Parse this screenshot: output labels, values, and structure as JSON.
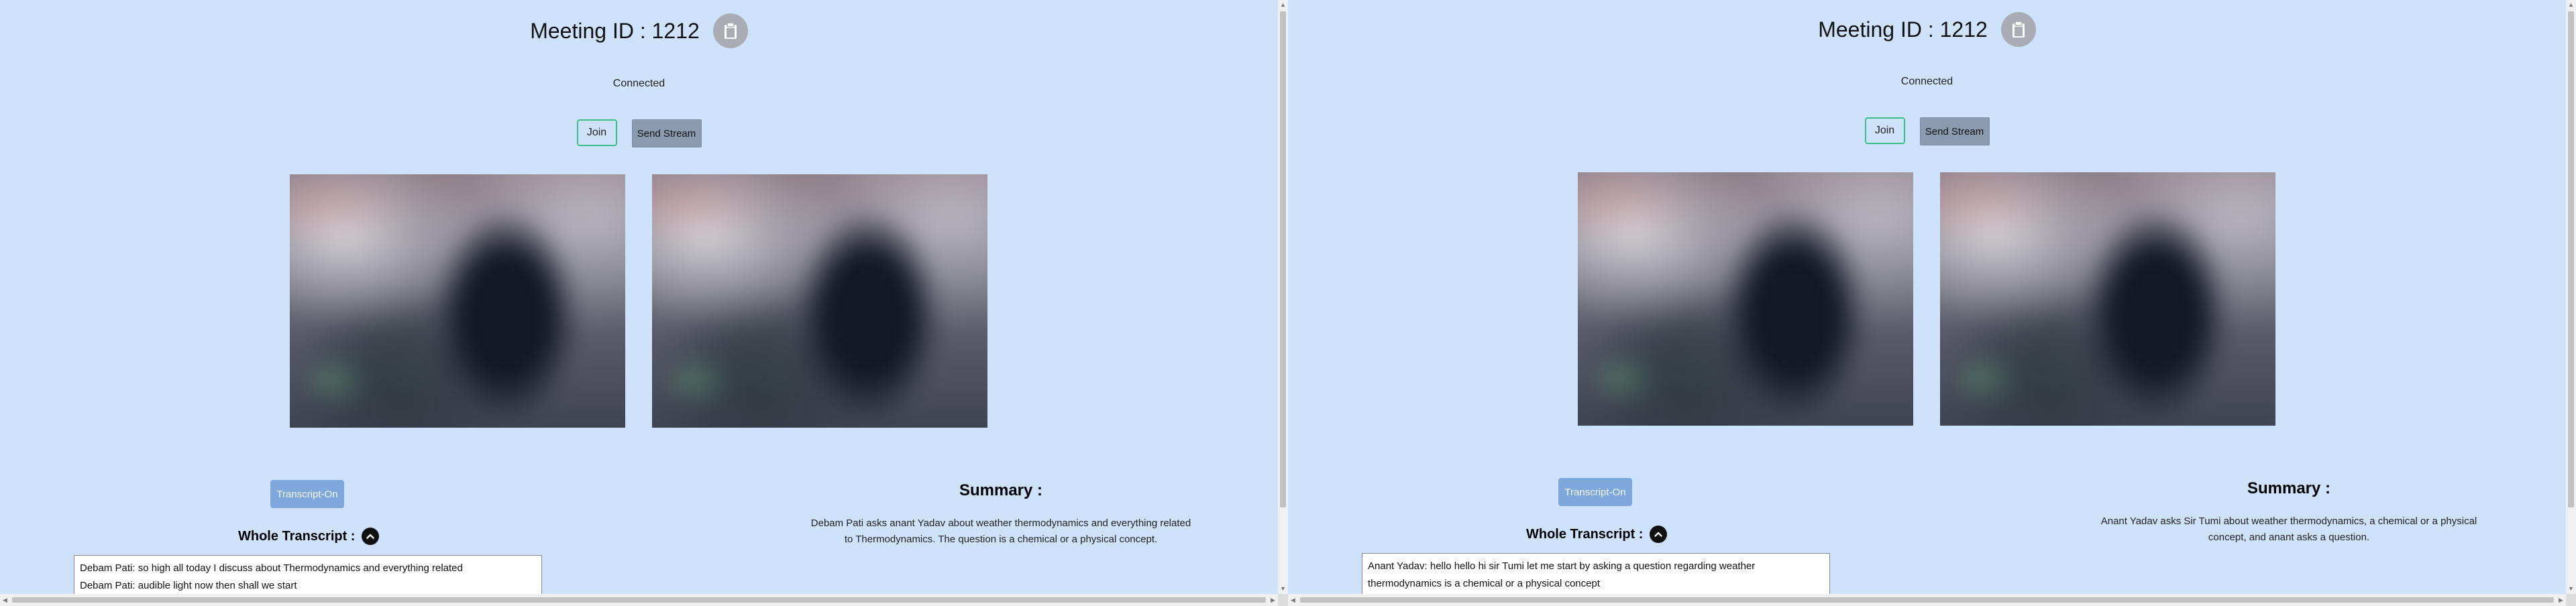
{
  "panels": [
    {
      "meeting_id_label": "Meeting ID : 1212",
      "copy_icon": "clipboard-icon",
      "status": "Connected",
      "join_label": "Join",
      "send_stream_label": "Send Stream",
      "transcript_toggle_label": "Transcript-On",
      "whole_transcript_label": "Whole Transcript :",
      "collapse_icon": "chevron-up-icon",
      "transcript_lines": [
        "Debam Pati: so high all today I discuss about Thermodynamics and everything related",
        "Debam Pati: audible light now then shall we start"
      ],
      "summary_title": "Summary :",
      "summary_line1": "Debam Pati asks anant Yadav about weather thermodynamics and everything related",
      "summary_line2": "to Thermodynamics. The question is a chemical or a physical concept."
    },
    {
      "meeting_id_label": "Meeting ID : 1212",
      "copy_icon": "clipboard-icon",
      "status": "Connected",
      "join_label": "Join",
      "send_stream_label": "Send Stream",
      "transcript_toggle_label": "Transcript-On",
      "whole_transcript_label": "Whole Transcript :",
      "collapse_icon": "chevron-up-icon",
      "transcript_lines": [
        "Anant Yadav: hello hello hi sir Tumi let me start by asking a question regarding weather",
        "thermodynamics is a chemical or a physical concept"
      ],
      "summary_title": "Summary :",
      "summary_line1": "Anant Yadav asks Sir Tumi about weather thermodynamics, a chemical or a physical",
      "summary_line2": "concept, and anant asks a question."
    }
  ],
  "colors": {
    "background": "#cfe2fb",
    "join_border": "#3cc08a",
    "send_stream_bg": "#8a9bb0",
    "transcript_toggle_bg": "#7ea8dc",
    "copy_button_bg": "#a9adb3"
  }
}
